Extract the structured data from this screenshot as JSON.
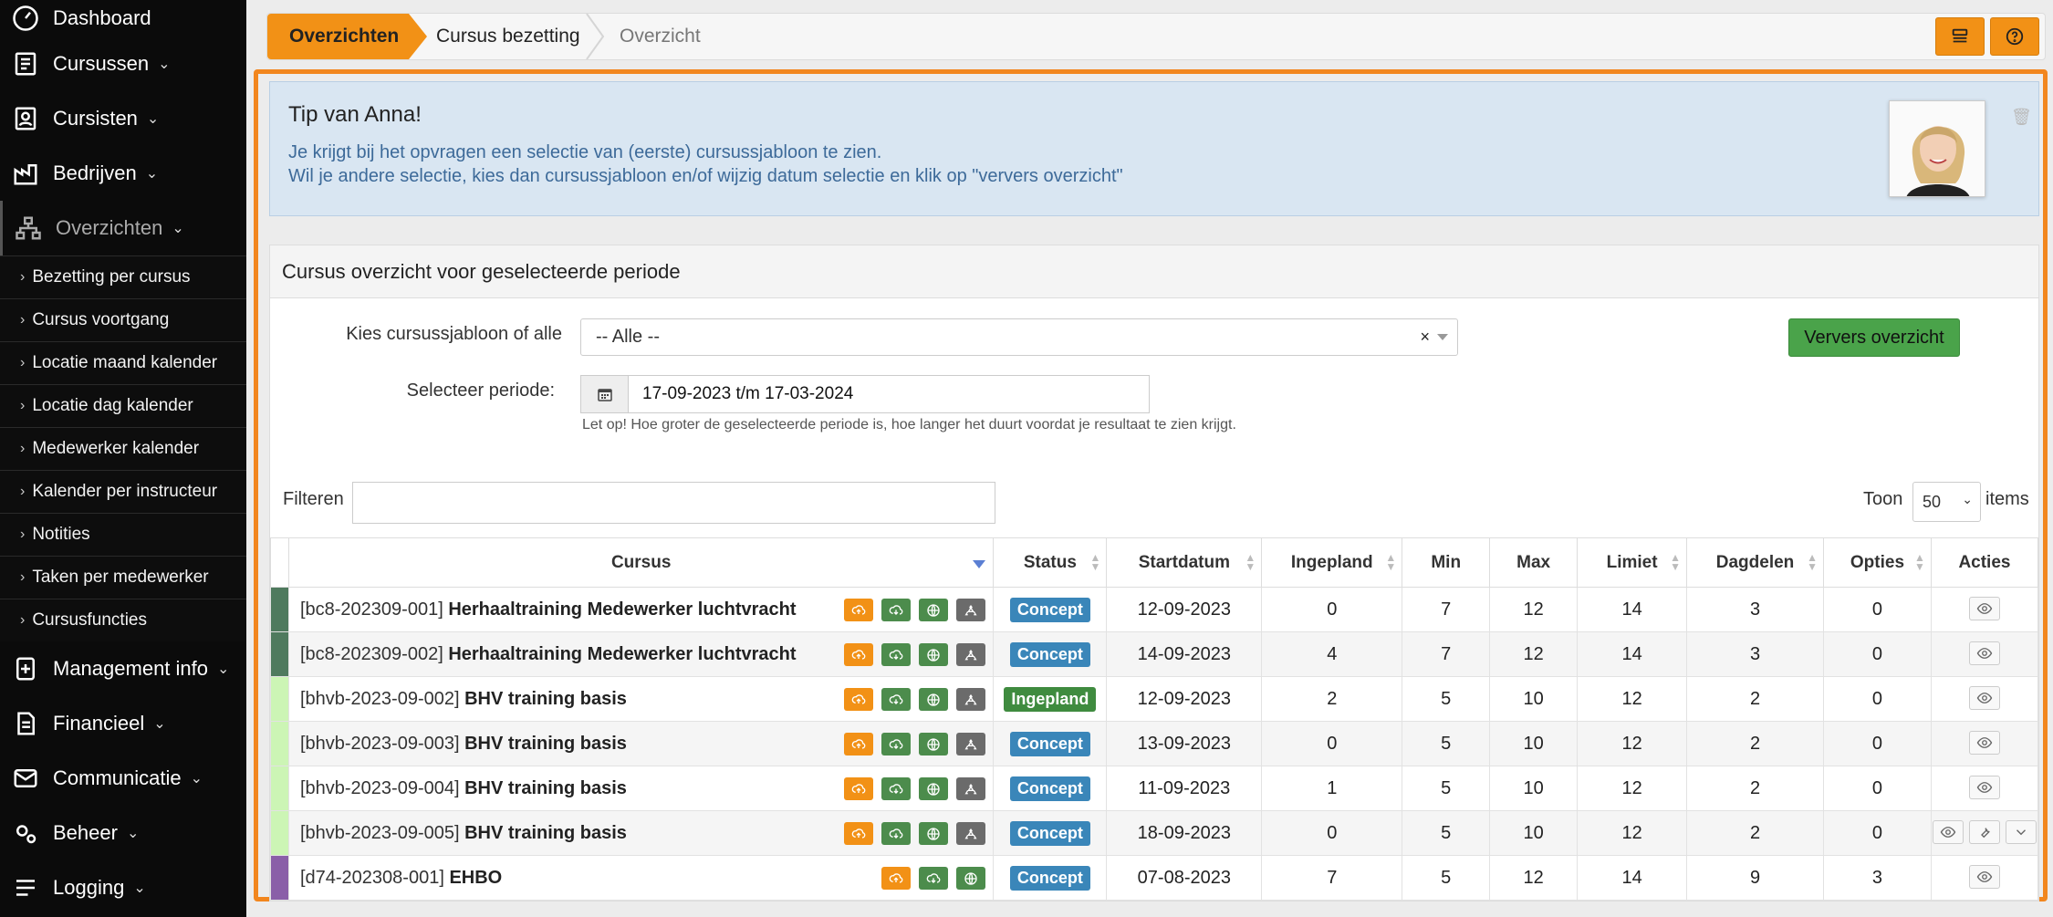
{
  "sidebar": {
    "main_items": [
      {
        "label": "Dashboard",
        "icon": "dashboard-icon"
      },
      {
        "label": "Cursussen",
        "icon": "book-icon"
      },
      {
        "label": "Cursisten",
        "icon": "user-card-icon"
      },
      {
        "label": "Bedrijven",
        "icon": "factory-icon"
      },
      {
        "label": "Overzichten",
        "icon": "sitemap-icon"
      }
    ],
    "sub_items": [
      "Bezetting per cursus",
      "Cursus voortgang",
      "Locatie maand kalender",
      "Locatie dag kalender",
      "Medewerker kalender",
      "Kalender per instructeur",
      "Notities",
      "Taken per medewerker",
      "Cursusfuncties"
    ],
    "bottom_items": [
      {
        "label": "Management info",
        "icon": "chart-icon"
      },
      {
        "label": "Financieel",
        "icon": "invoice-icon"
      },
      {
        "label": "Communicatie",
        "icon": "mail-icon"
      },
      {
        "label": "Beheer",
        "icon": "gears-icon"
      },
      {
        "label": "Logging",
        "icon": "logging-icon"
      }
    ]
  },
  "breadcrumb": {
    "items": [
      "Overzichten",
      "Cursus bezetting",
      "Overzicht"
    ]
  },
  "tip": {
    "title": "Tip van Anna!",
    "line1": "Je krijgt bij het opvragen een selectie van (eerste) cursussjabloon te zien.",
    "line2": "Wil je andere selectie, kies dan cursussjabloon en/of wijzig datum selectie en klik op \"ververs overzicht\""
  },
  "panel": {
    "title": "Cursus overzicht voor geselecteerde periode",
    "template_label": "Kies cursussjabloon of alle",
    "template_value": "-- Alle --",
    "refresh_label": "Ververs overzicht",
    "period_label": "Selecteer periode:",
    "period_value": "17-09-2023 t/m 17-03-2024",
    "period_hint": "Let op! Hoe groter de geselecteerde periode is, hoe langer het duurt voordat je resultaat te zien krijgt.",
    "filter_label": "Filteren",
    "show_label": "Toon",
    "show_value": "50",
    "items_label": "items"
  },
  "table": {
    "headers": [
      "Cursus",
      "Status",
      "Startdatum",
      "Ingepland",
      "Min",
      "Max",
      "Limiet",
      "Dagdelen",
      "Opties",
      "Acties"
    ],
    "rows": [
      {
        "code": "[bc8-202309-001]",
        "name": "Herhaaltraining Medewerker luchtvracht",
        "status": "Concept",
        "start": "12-09-2023",
        "ingepland": "0",
        "min": "7",
        "max": "12",
        "limiet": "14",
        "dagdelen": "3",
        "opties": "0",
        "color": "#4f7a5e"
      },
      {
        "code": "[bc8-202309-002]",
        "name": "Herhaaltraining Medewerker luchtvracht",
        "status": "Concept",
        "start": "14-09-2023",
        "ingepland": "4",
        "min": "7",
        "max": "12",
        "limiet": "14",
        "dagdelen": "3",
        "opties": "0",
        "color": "#4f7a5e"
      },
      {
        "code": "[bhvb-2023-09-002]",
        "name": "BHV training basis",
        "status": "Ingepland",
        "start": "12-09-2023",
        "ingepland": "2",
        "min": "5",
        "max": "10",
        "limiet": "12",
        "dagdelen": "2",
        "opties": "0",
        "color": "#ccf5b5"
      },
      {
        "code": "[bhvb-2023-09-003]",
        "name": "BHV training basis",
        "status": "Concept",
        "start": "13-09-2023",
        "ingepland": "0",
        "min": "5",
        "max": "10",
        "limiet": "12",
        "dagdelen": "2",
        "opties": "0",
        "color": "#ccf5b5"
      },
      {
        "code": "[bhvb-2023-09-004]",
        "name": "BHV training basis",
        "status": "Concept",
        "start": "11-09-2023",
        "ingepland": "1",
        "min": "5",
        "max": "10",
        "limiet": "12",
        "dagdelen": "2",
        "opties": "0",
        "color": "#ccf5b5"
      },
      {
        "code": "[bhvb-2023-09-005]",
        "name": "BHV training basis",
        "status": "Concept",
        "start": "18-09-2023",
        "ingepland": "0",
        "min": "5",
        "max": "10",
        "limiet": "12",
        "dagdelen": "2",
        "opties": "0",
        "color": "#ccf5b5"
      },
      {
        "code": "[d74-202308-001]",
        "name": "EHBO",
        "status": "Concept",
        "start": "07-08-2023",
        "ingepland": "7",
        "min": "5",
        "max": "12",
        "limiet": "14",
        "dagdelen": "9",
        "opties": "3",
        "color": "#8a5fa8"
      }
    ]
  },
  "colors": {
    "accent": "#f29116",
    "frame": "#f2861e",
    "concept": "#3a86b9",
    "ingepland": "#3f8b3f"
  }
}
